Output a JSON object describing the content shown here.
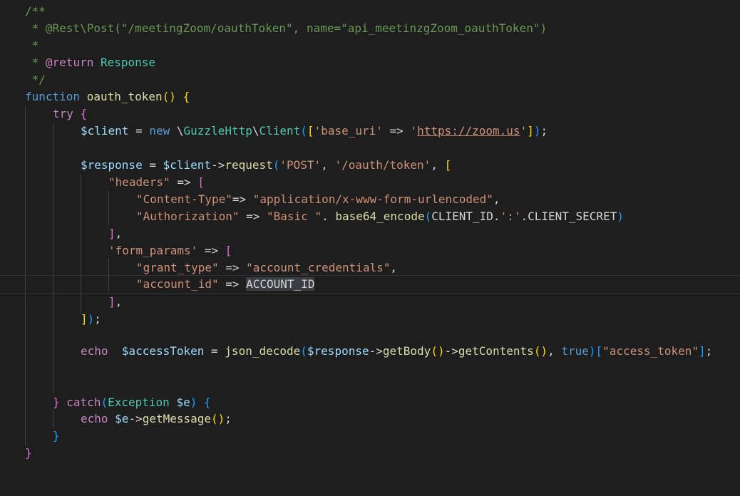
{
  "editor": {
    "theme": "dark",
    "colors": {
      "background": "#1e1e1e",
      "comment": "#6a9955",
      "keyword": "#569cd6",
      "control": "#c586c0",
      "function": "#dcdcaa",
      "variable": "#9cdcfe",
      "string": "#ce9178",
      "class": "#4ec9b0",
      "bracket_1": "#ffd700",
      "bracket_2": "#da70d6",
      "bracket_3": "#179fff"
    },
    "lines": [
      {
        "id": "l1",
        "text": "/**"
      },
      {
        "id": "l2",
        "text": " * @Rest\\Post(\"/meetingZoom/oauthToken\", name=\"api_meetinzgZoom_oauthToken\")"
      },
      {
        "id": "l3",
        "text": " *"
      },
      {
        "id": "l4",
        "text": " * @return Response"
      },
      {
        "id": "l5",
        "text": " */"
      },
      {
        "id": "l6",
        "text": "function oauth_token() {"
      },
      {
        "id": "l7",
        "text": "try {"
      },
      {
        "id": "l8",
        "text": "$client = new \\GuzzleHttp\\Client(['base_uri' => 'https://zoom.us']);"
      },
      {
        "id": "l9",
        "text": ""
      },
      {
        "id": "l10",
        "text": "$response = $client->request('POST', '/oauth/token', ["
      },
      {
        "id": "l11",
        "text": "\"headers\" => ["
      },
      {
        "id": "l12",
        "text": "\"Content-Type\"=> \"application/x-www-form-urlencoded\","
      },
      {
        "id": "l13",
        "text": "\"Authorization\" => \"Basic \". base64_encode(CLIENT_ID.':'.CLIENT_SECRET)"
      },
      {
        "id": "l14",
        "text": "],"
      },
      {
        "id": "l15",
        "text": "'form_params' => ["
      },
      {
        "id": "l16",
        "text": "\"grant_type\" => \"account_credentials\","
      },
      {
        "id": "l17",
        "text": "\"account_id\" => ACCOUNT_ID"
      },
      {
        "id": "l18",
        "text": "],"
      },
      {
        "id": "l19",
        "text": "]);"
      },
      {
        "id": "l20",
        "text": ""
      },
      {
        "id": "l21",
        "text": "echo  $accessToken = json_decode($response->getBody()->getContents(), true)[\"access_token\"];"
      },
      {
        "id": "l22",
        "text": ""
      },
      {
        "id": "l23",
        "text": ""
      },
      {
        "id": "l24",
        "text": "} catch(Exception $e) {"
      },
      {
        "id": "l25",
        "text": "echo $e->getMessage();"
      },
      {
        "id": "l26",
        "text": "}"
      },
      {
        "id": "l27",
        "text": "}"
      }
    ],
    "selected_word": "ACCOUNT_ID"
  }
}
